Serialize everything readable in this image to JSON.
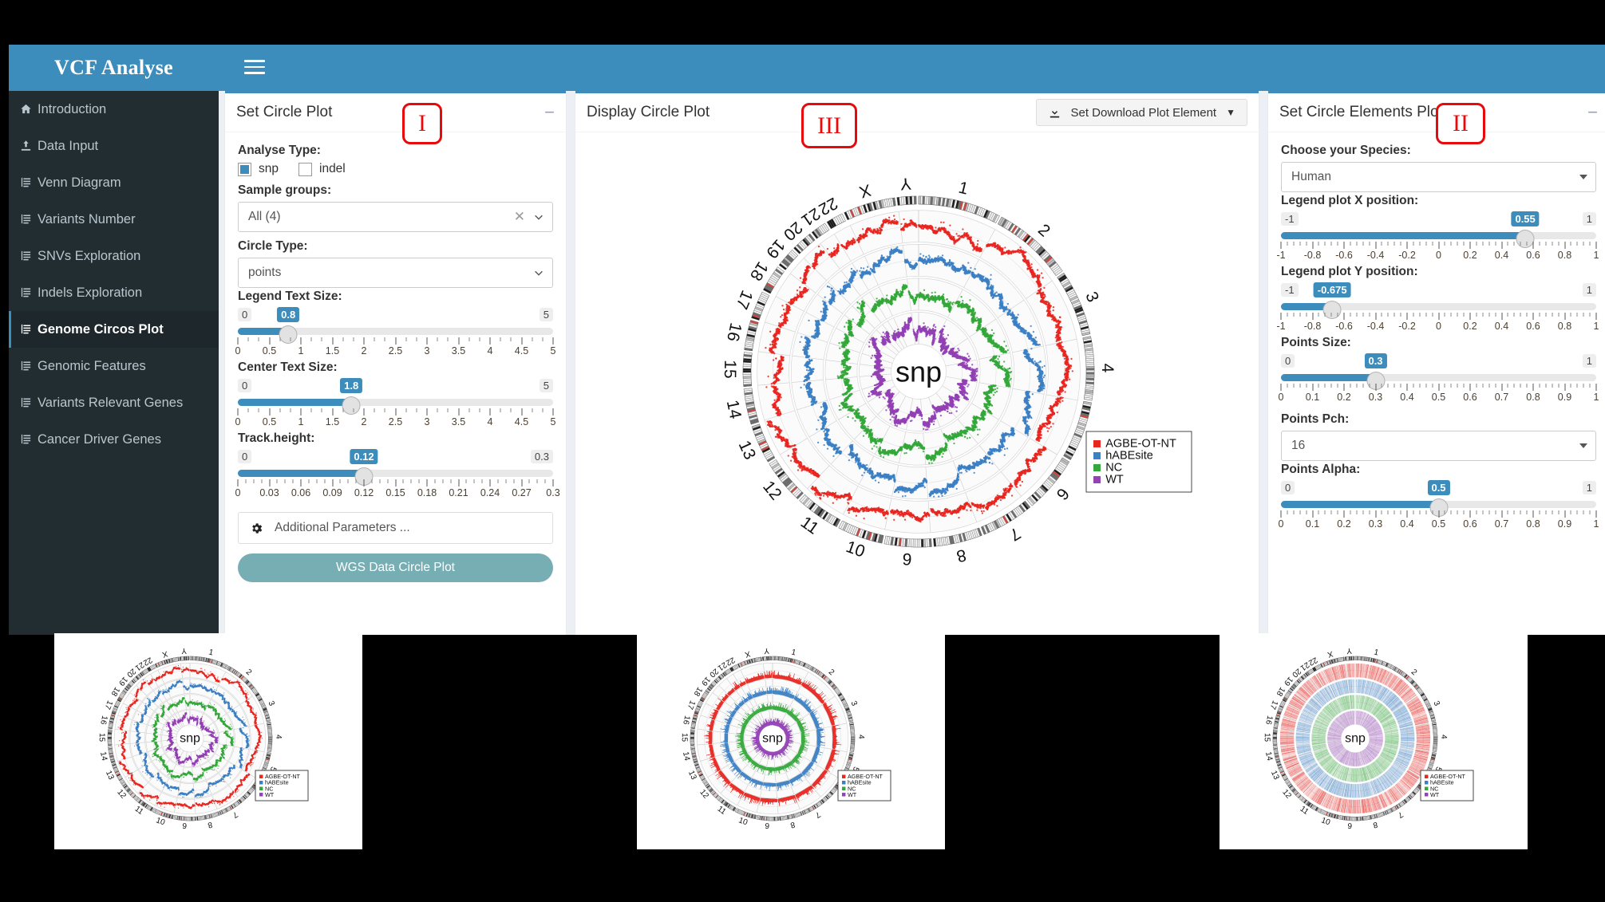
{
  "brand": {
    "title": "VCF Analyse"
  },
  "topbar": {
    "menu_icon": "hamburger-icon"
  },
  "sidebar": {
    "items": [
      {
        "label": "Introduction",
        "icon": "home-icon",
        "active": false
      },
      {
        "label": "Data Input",
        "icon": "upload-icon",
        "active": false
      },
      {
        "label": "Venn Diagram",
        "icon": "list-icon",
        "active": false
      },
      {
        "label": "Variants Number",
        "icon": "list-icon",
        "active": false
      },
      {
        "label": "SNVs Exploration",
        "icon": "list-icon",
        "active": false
      },
      {
        "label": "Indels Exploration",
        "icon": "list-icon",
        "active": false
      },
      {
        "label": "Genome Circos Plot",
        "icon": "list-icon",
        "active": true
      },
      {
        "label": "Genomic Features",
        "icon": "list-icon",
        "active": false
      },
      {
        "label": "Variants Relevant Genes",
        "icon": "list-icon",
        "active": false
      },
      {
        "label": "Cancer Driver Genes",
        "icon": "list-icon",
        "active": false
      }
    ]
  },
  "panel_I": {
    "title": "Set Circle Plot",
    "marker": "I",
    "collapse_label": "−",
    "analyse_type_label": "Analyse Type:",
    "checkboxes": [
      {
        "label": "snp",
        "checked": true
      },
      {
        "label": "indel",
        "checked": false
      }
    ],
    "sample_groups_label": "Sample groups:",
    "sample_groups_value": "All (4)",
    "circle_type_label": "Circle Type:",
    "circle_type_value": "points",
    "sliders": [
      {
        "label": "Legend Text Size:",
        "value": 0.8,
        "value_text": "0.8",
        "min": 0,
        "max": 5,
        "min_text": "0",
        "max_text": "5",
        "ticks": [
          "0",
          "0.5",
          "1",
          "1.5",
          "2",
          "2.5",
          "3",
          "3.5",
          "4",
          "4.5",
          "5"
        ],
        "minor_per_major": 2
      },
      {
        "label": "Center Text Size:",
        "value": 1.8,
        "value_text": "1.8",
        "min": 0,
        "max": 5,
        "min_text": "0",
        "max_text": "5",
        "ticks": [
          "0",
          "0.5",
          "1",
          "1.5",
          "2",
          "2.5",
          "3",
          "3.5",
          "4",
          "4.5",
          "5"
        ],
        "minor_per_major": 2
      },
      {
        "label": "Track.height:",
        "value": 0.12,
        "value_text": "0.12",
        "min": 0,
        "max": 0.3,
        "min_text": "0",
        "max_text": "0.3",
        "ticks": [
          "0",
          "0.03",
          "0.06",
          "0.09",
          "0.12",
          "0.15",
          "0.18",
          "0.21",
          "0.24",
          "0.27",
          "0.3"
        ],
        "minor_per_major": 3
      }
    ],
    "additional_parameters_label": "Additional Parameters ...",
    "additional_parameters_icon": "gear-icon",
    "submit_label": "WGS Data Circle Plot"
  },
  "panel_II": {
    "title": "Set Circle Elements Plot",
    "marker": "II",
    "collapse_label": "−",
    "species_label": "Choose your Species:",
    "species_value": "Human",
    "sliders": [
      {
        "label": "Legend plot X position:",
        "value": 0.55,
        "value_text": "0.55",
        "min": -1,
        "max": 1,
        "min_text": "-1",
        "max_text": "1",
        "ticks": [
          "-1",
          "-0.8",
          "-0.6",
          "-0.4",
          "-0.2",
          "0",
          "0.2",
          "0.4",
          "0.6",
          "0.8",
          "1"
        ],
        "minor_per_major": 4
      },
      {
        "label": "Legend plot Y position:",
        "value": -0.675,
        "value_text": "-0.675",
        "min": -1,
        "max": 1,
        "min_text": "-1",
        "max_text": "1",
        "ticks": [
          "-1",
          "-0.8",
          "-0.6",
          "-0.4",
          "-0.2",
          "0",
          "0.2",
          "0.4",
          "0.6",
          "0.8",
          "1"
        ],
        "minor_per_major": 4
      },
      {
        "label": "Points Size:",
        "value": 0.3,
        "value_text": "0.3",
        "min": 0,
        "max": 1,
        "min_text": "0",
        "max_text": "1",
        "ticks": [
          "0",
          "0.1",
          "0.2",
          "0.3",
          "0.4",
          "0.5",
          "0.6",
          "0.7",
          "0.8",
          "0.9",
          "1"
        ],
        "minor_per_major": 4
      }
    ],
    "pch_label": "Points Pch:",
    "pch_value": "16",
    "alpha_slider": {
      "label": "Points Alpha:",
      "value": 0.5,
      "value_text": "0.5",
      "min": 0,
      "max": 1,
      "min_text": "0",
      "max_text": "1",
      "ticks": [
        "0",
        "0.1",
        "0.2",
        "0.3",
        "0.4",
        "0.5",
        "0.6",
        "0.7",
        "0.8",
        "0.9",
        "1"
      ],
      "minor_per_major": 4
    }
  },
  "panel_III": {
    "title": "Display Circle Plot",
    "marker": "III",
    "download_label": "Set Download Plot Element",
    "download_icon": "download-icon",
    "caret_icon": "caret-down-icon"
  },
  "chart_data": {
    "type": "scatter",
    "title": "snp",
    "center_label": "snp",
    "plot_style": "circos",
    "ideogram_labels": [
      "1",
      "2",
      "3",
      "4",
      "5",
      "6",
      "7",
      "8",
      "9",
      "10",
      "11",
      "12",
      "13",
      "14",
      "15",
      "16",
      "17",
      "18",
      "19",
      "20",
      "21",
      "22",
      "X",
      "Y"
    ],
    "tracks": [
      {
        "name": "AGBE-OT-NT",
        "color": "#e8251f",
        "ring": 1
      },
      {
        "name": "hABEsite",
        "color": "#3b7fc4",
        "ring": 2
      },
      {
        "name": "NC",
        "color": "#34a83a",
        "ring": 3
      },
      {
        "name": "WT",
        "color": "#9341b5",
        "ring": 4
      }
    ],
    "legend": {
      "position": "bottom-right",
      "entries": [
        {
          "label": "AGBE-OT-NT",
          "color": "#e8251f"
        },
        {
          "label": "hABEsite",
          "color": "#3b7fc4"
        },
        {
          "label": "NC",
          "color": "#34a83a"
        },
        {
          "label": "WT",
          "color": "#9341b5"
        }
      ]
    }
  },
  "thumbnails": [
    {
      "name": "points-circos-thumbnail",
      "center_label": "snp",
      "style": "points"
    },
    {
      "name": "line-circos-thumbnail",
      "center_label": "snp",
      "style": "line"
    },
    {
      "name": "heatmap-circos-thumbnail",
      "center_label": "snp",
      "style": "heatmap"
    }
  ]
}
